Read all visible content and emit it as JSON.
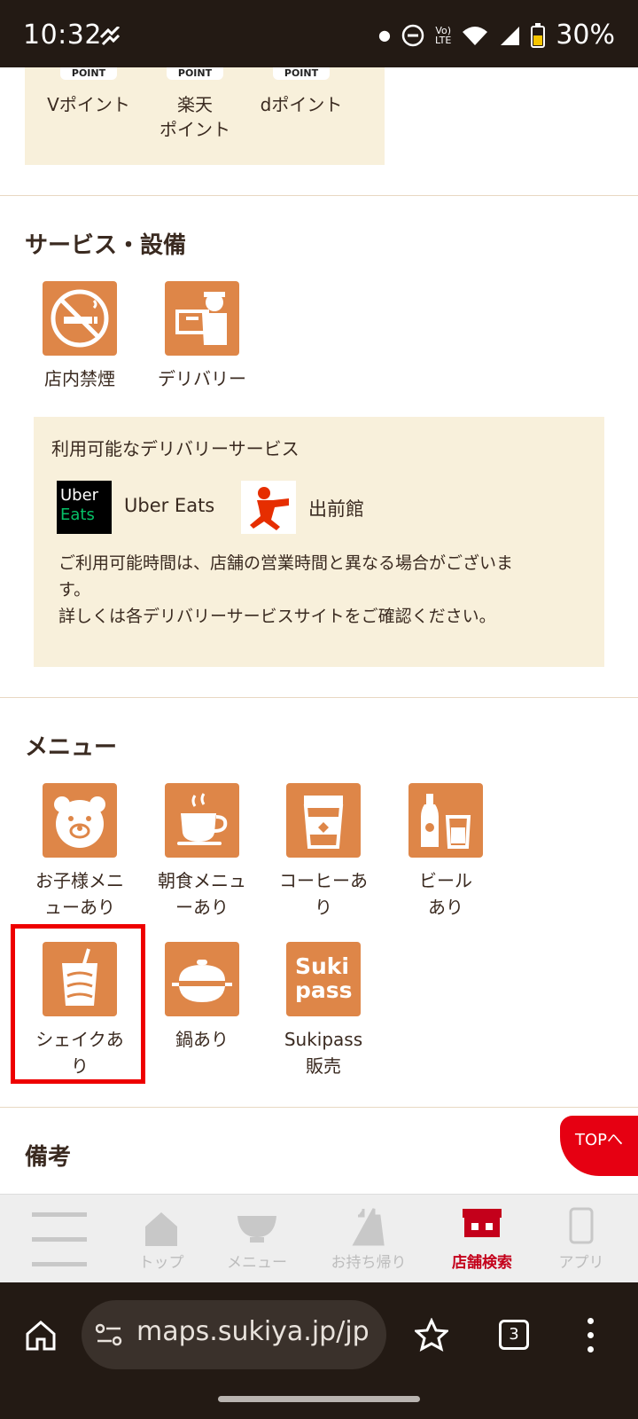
{
  "status_bar": {
    "time": "10:32",
    "battery": "30%"
  },
  "points": {
    "logos": [
      "POINT",
      "POINT",
      "POINT"
    ],
    "items": [
      {
        "label": "Vポイント"
      },
      {
        "label_line1": "楽天",
        "label_line2": "ポイント"
      },
      {
        "label": "dポイント"
      }
    ]
  },
  "services": {
    "title": "サービス・設備",
    "items": [
      {
        "label": "店内禁煙",
        "icon": "no-smoking-icon"
      },
      {
        "label": "デリバリー",
        "icon": "delivery-icon"
      }
    ],
    "delivery": {
      "heading": "利用可能なデリバリーサービス",
      "uber_logo_line1": "Uber",
      "uber_logo_line2": "Eats",
      "uber_name": "Uber Eats",
      "demaekan_name": "出前館",
      "note_line1": "ご利用可能時間は、店舗の営業時間と異なる場合がございま",
      "note_line2": "す。",
      "note_line3": "詳しくは各デリバリーサービスサイトをご確認ください。"
    }
  },
  "menu": {
    "title": "メニュー",
    "items": [
      {
        "line1": "お子様メニ",
        "line2": "ューあり",
        "icon": "bear-icon"
      },
      {
        "line1": "朝食メニュ",
        "line2": "ーあり",
        "icon": "coffee-cup-icon"
      },
      {
        "line1": "コーヒーあ",
        "line2": "り",
        "icon": "takeout-coffee-icon"
      },
      {
        "line1": "ビール",
        "line2": "あり",
        "icon": "beer-icon"
      },
      {
        "line1": "シェイクあ",
        "line2": "り",
        "icon": "shake-icon"
      },
      {
        "line1": "鍋あり",
        "line2": "",
        "icon": "pot-icon"
      },
      {
        "line1": "Sukipass",
        "line2": "販売",
        "icon": "sukipass-icon",
        "logo_line1": "Suki",
        "logo_line2": "pass"
      }
    ]
  },
  "notes_title": "備考",
  "top_button": "TOPへ",
  "site_nav": {
    "items": [
      "トップ",
      "メニュー",
      "お持ち帰り",
      "店舗検索",
      "アプリ"
    ],
    "active": "店舗検索"
  },
  "browser": {
    "url": "maps.sukiya.jp/jp",
    "tab_count": "3"
  },
  "colors": {
    "accent": "#de8648",
    "brand_red": "#e60012",
    "card_bg": "#f8f0db"
  }
}
